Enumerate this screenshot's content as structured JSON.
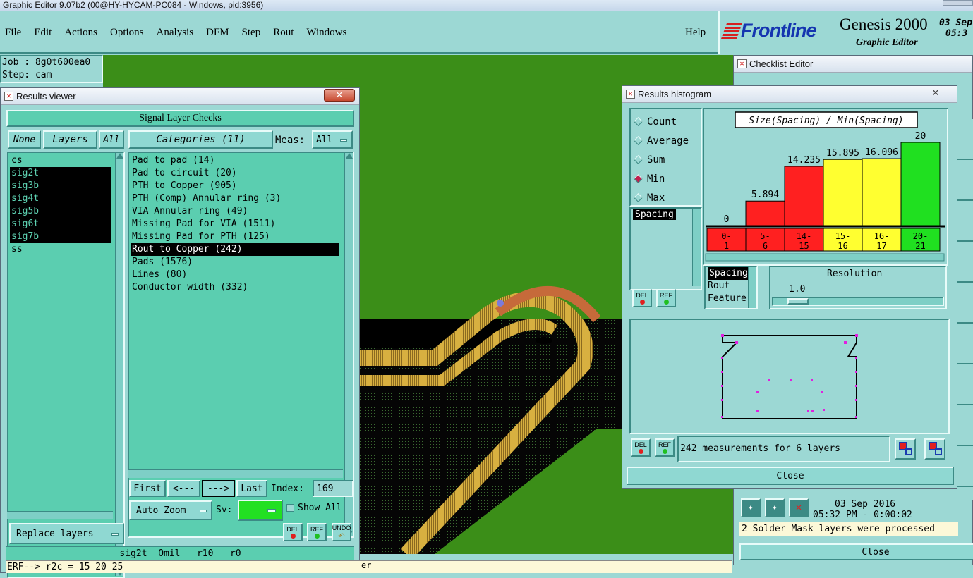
{
  "os_title": "Graphic Editor 9.07b2 (00@HY-HYCAM-PC084 - Windows, pid:3956)",
  "menu": [
    "File",
    "Edit",
    "Actions",
    "Options",
    "Analysis",
    "DFM",
    "Step",
    "Rout",
    "Windows"
  ],
  "help": "Help",
  "brand": {
    "logo": "Frontline",
    "product": "Genesis 2000",
    "subtitle": "Graphic Editor",
    "date_partial": "03  Sep",
    "time_partial": "05:3"
  },
  "job": {
    "job": "Job : 8g0t600ea0",
    "step": "Step: cam"
  },
  "results_viewer": {
    "title": "Results viewer",
    "header": "Signal Layer Checks",
    "none": "None",
    "layers": "Layers",
    "all": "All",
    "categories": "Categories (11)",
    "meas_label": "Meas:",
    "meas_value": "All",
    "layer_list": [
      {
        "name": "cs",
        "selected": false
      },
      {
        "name": "sig2t",
        "selected": true
      },
      {
        "name": "sig3b",
        "selected": true
      },
      {
        "name": "sig4t",
        "selected": true
      },
      {
        "name": "sig5b",
        "selected": true
      },
      {
        "name": "sig6t",
        "selected": true
      },
      {
        "name": "sig7b",
        "selected": true
      },
      {
        "name": "ss",
        "selected": false
      }
    ],
    "category_list": [
      {
        "name": "Pad to pad (14)",
        "selected": false
      },
      {
        "name": "Pad to circuit (20)",
        "selected": false
      },
      {
        "name": "PTH to Copper (905)",
        "selected": false
      },
      {
        "name": "PTH (Comp) Annular ring (3)",
        "selected": false
      },
      {
        "name": "VIA Annular ring (49)",
        "selected": false
      },
      {
        "name": "Missing Pad for VIA (1511)",
        "selected": false
      },
      {
        "name": "Missing Pad for PTH (125)",
        "selected": false
      },
      {
        "name": "Rout to Copper (242)",
        "selected": true
      },
      {
        "name": "Pads (1576)",
        "selected": false
      },
      {
        "name": "Lines (80)",
        "selected": false
      },
      {
        "name": "Conductor width (332)",
        "selected": false
      }
    ],
    "first": "First",
    "prev": "<---",
    "next": "--->",
    "last": "Last",
    "index_label": "Index:",
    "index_value": "169",
    "auto_zoom": "Auto Zoom",
    "sv_label": "Sv:",
    "show_all": "Show All",
    "replace_layers": "Replace layers",
    "del": "DEL",
    "ref": "REF",
    "undo": "UNDO",
    "status": "sig2t  Omil   r10   r0"
  },
  "command_line": "ERF--> r2c = 15 20 25",
  "command_line_tail": "er",
  "results_histogram": {
    "title": "Results histogram",
    "modes": [
      {
        "label": "Count",
        "selected": false
      },
      {
        "label": "Average",
        "selected": false
      },
      {
        "label": "Sum",
        "selected": false
      },
      {
        "label": "Min",
        "selected": true
      },
      {
        "label": "Max",
        "selected": false
      }
    ],
    "list_item": "Spacing",
    "attr_list": [
      "Spacing",
      "Rout",
      "Feature"
    ],
    "resolution_label": "Resolution",
    "resolution_value": "1.0",
    "measurements": "242 measurements for 6 layers",
    "close": "Close",
    "del": "DEL",
    "ref": "REF"
  },
  "chart_data": {
    "type": "bar",
    "title": "Size(Spacing) / Min(Spacing)",
    "categories": [
      "0-1",
      "5-6",
      "14-15",
      "15-16",
      "16-17",
      "20-21"
    ],
    "values": [
      0,
      5.894,
      14.235,
      15.895,
      16.096,
      20
    ],
    "value_labels": [
      "0",
      "5.894",
      "14.235",
      "15.895",
      "16.096",
      "20"
    ],
    "colors": [
      "#ff2020",
      "#ff2020",
      "#ff2020",
      "#ffff30",
      "#ffff30",
      "#20e020"
    ],
    "ylim": [
      0,
      20
    ]
  },
  "checklist_editor": {
    "title": "Checklist Editor",
    "date": "03 Sep 2016",
    "time": "05:32 PM - 0:00:02",
    "message": "2 Solder Mask layers were processed",
    "close": "Close"
  }
}
